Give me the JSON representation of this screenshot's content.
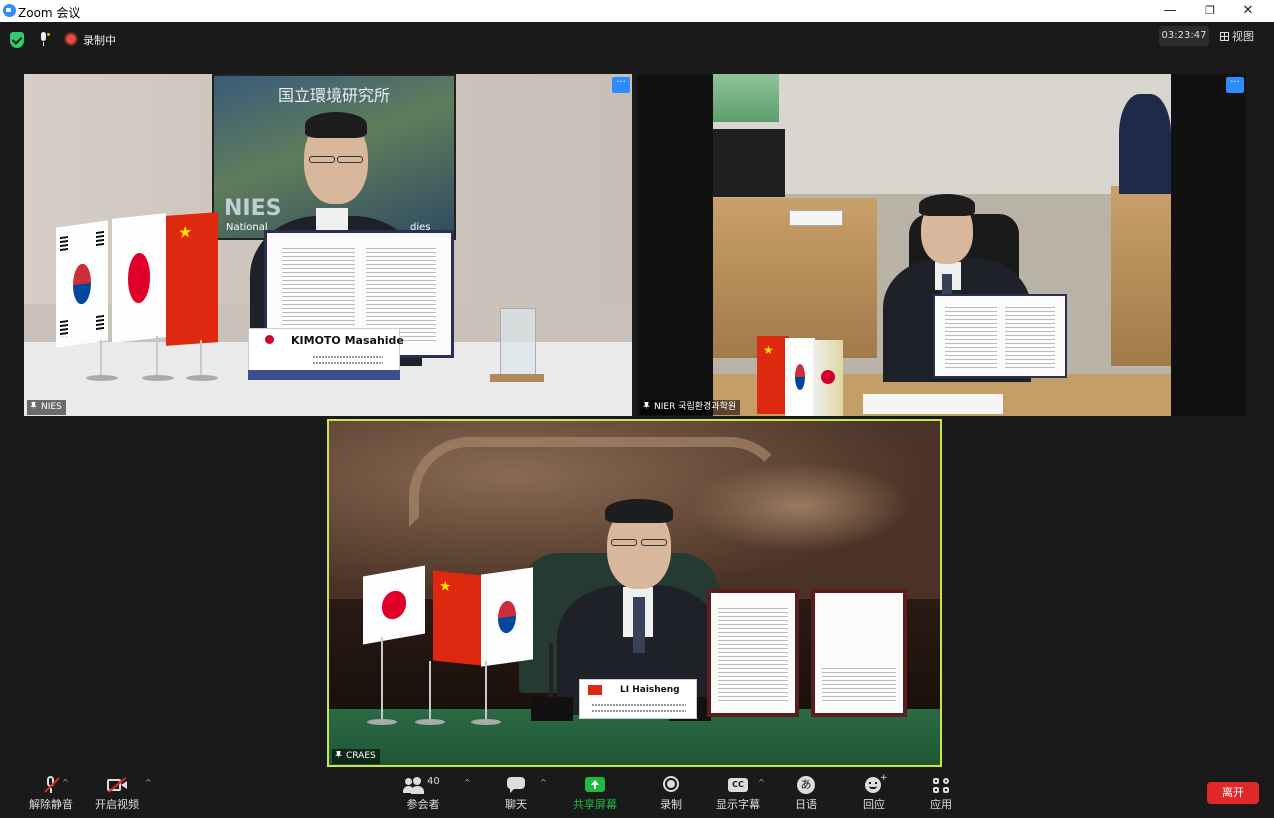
{
  "window": {
    "title": "Zoom 会议",
    "minimize_glyph": "—",
    "restore_glyph": "❐",
    "close_glyph": "✕"
  },
  "status": {
    "recording_label": "录制中",
    "timer": "03:23:47",
    "view_label": "视图"
  },
  "tiles": [
    {
      "label": "NIES",
      "building_sign": "国立環境研究所",
      "sign_caption_left": "National",
      "sign_caption_right": "dies",
      "sign_caption_logo": "NIES",
      "nameplate_name": "KIMOTO  Masahide",
      "flags": [
        "korea",
        "japan",
        "china"
      ]
    },
    {
      "label": "NIER 국립환경과학원",
      "flags": [
        "china",
        "korea",
        "other"
      ]
    },
    {
      "label": "CRAES",
      "nameplate_name": "LI Haisheng",
      "flags": [
        "japan",
        "china",
        "korea"
      ],
      "active_speaker": true
    }
  ],
  "more_button_glyph": "···",
  "toolbar": {
    "unmute_label": "解除静音",
    "start_video_label": "开启视频",
    "participants_label": "参会者",
    "participants_count": "40",
    "chat_label": "聊天",
    "share_label": "共享屏幕",
    "record_label": "录制",
    "captions_label": "显示字幕",
    "captions_icon_text": "CC",
    "language_label": "日语",
    "language_icon_text": "あ",
    "reactions_label": "回应",
    "apps_label": "应用",
    "leave_label": "离开",
    "caret_glyph": "^"
  },
  "icons": {
    "security": "shield-icon",
    "mic_status": "mic-icon",
    "recording": "record-dot-icon",
    "view": "grid-icon",
    "unmute": "mic-muted-icon",
    "video": "video-off-icon",
    "participants": "people-icon",
    "chat": "chat-bubble-icon",
    "share": "share-screen-icon",
    "record": "record-icon",
    "captions": "cc-icon",
    "language": "language-icon",
    "reactions": "smiley-icon",
    "apps": "apps-icon",
    "pin": "pin-icon"
  },
  "colors": {
    "background": "#1a1a1a",
    "accent_blue": "#2d8cff",
    "share_green": "#1fba3d",
    "leave_red": "#e02828",
    "active_speaker_border": "#c9e64b",
    "recording_red": "#e74c3c",
    "security_green": "#2ecc71"
  }
}
